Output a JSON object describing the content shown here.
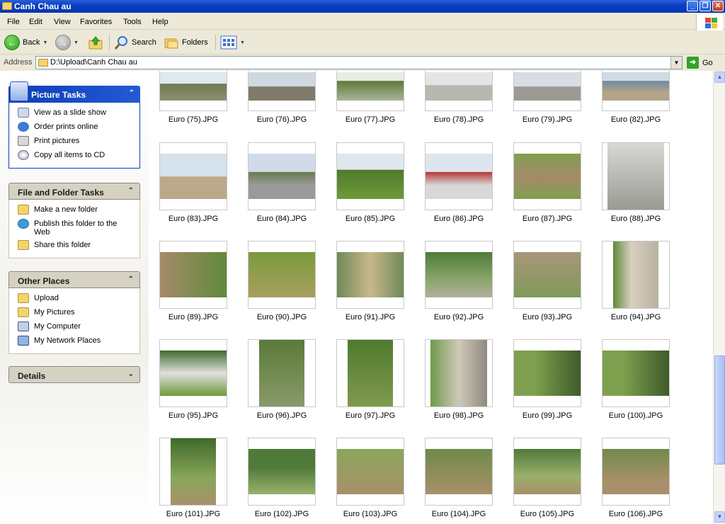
{
  "window": {
    "title": "Canh Chau au"
  },
  "menu": [
    "File",
    "Edit",
    "View",
    "Favorites",
    "Tools",
    "Help"
  ],
  "toolbar": {
    "back": "Back",
    "search": "Search",
    "folders": "Folders"
  },
  "address": {
    "label": "Address",
    "value": "D:\\Upload\\Canh Chau au",
    "go": "Go"
  },
  "picture_tasks": {
    "title": "Picture Tasks",
    "items": [
      "View as a slide show",
      "Order prints online",
      "Print pictures",
      "Copy all items to CD"
    ]
  },
  "file_folder_tasks": {
    "title": "File and Folder Tasks",
    "items": [
      "Make a new folder",
      "Publish this folder to the Web",
      "Share this folder"
    ]
  },
  "other_places": {
    "title": "Other Places",
    "items": [
      "Upload",
      "My Pictures",
      "My Computer",
      "My Network Places"
    ]
  },
  "details": {
    "title": "Details"
  },
  "files": [
    "Euro (75).JPG",
    "Euro (76).JPG",
    "Euro (77).JPG",
    "Euro (78).JPG",
    "Euro (79).JPG",
    "Euro (82).JPG",
    "Euro (83).JPG",
    "Euro (84).JPG",
    "Euro (85).JPG",
    "Euro (86).JPG",
    "Euro (87).JPG",
    "Euro (88).JPG",
    "Euro (89).JPG",
    "Euro (90).JPG",
    "Euro (91).JPG",
    "Euro (92).JPG",
    "Euro (93).JPG",
    "Euro (94).JPG",
    "Euro (95).JPG",
    "Euro (96).JPG",
    "Euro (97).JPG",
    "Euro (98).JPG",
    "Euro (99).JPG",
    "Euro (100).JPG",
    "Euro (101).JPG",
    "Euro (102).JPG",
    "Euro (103).JPG",
    "Euro (104).JPG",
    "Euro (105).JPG",
    "Euro (106).JPG"
  ],
  "colors": {
    "title_bar": "#0a3fc4",
    "task_pane_header": "#0c3fb3",
    "content_bg": "#ffffff"
  }
}
